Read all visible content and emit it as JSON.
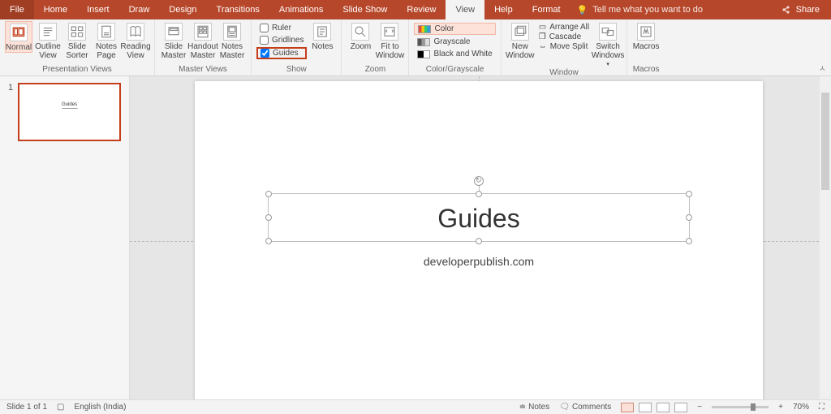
{
  "tabs": {
    "file": "File",
    "home": "Home",
    "insert": "Insert",
    "draw": "Draw",
    "design": "Design",
    "transitions": "Transitions",
    "animations": "Animations",
    "slideshow": "Slide Show",
    "review": "Review",
    "view": "View",
    "help": "Help",
    "format": "Format",
    "tellme": "Tell me what you want to do",
    "share": "Share"
  },
  "ribbon": {
    "presentation_views": "Presentation Views",
    "normal": "Normal",
    "outline_view": "Outline\nView",
    "slide_sorter": "Slide\nSorter",
    "notes_page": "Notes\nPage",
    "reading_view": "Reading\nView",
    "master_views": "Master Views",
    "slide_master": "Slide\nMaster",
    "handout_master": "Handout\nMaster",
    "notes_master": "Notes\nMaster",
    "show": "Show",
    "ruler": "Ruler",
    "gridlines": "Gridlines",
    "guides": "Guides",
    "notes": "Notes",
    "zoom_group": "Zoom",
    "zoom": "Zoom",
    "fit": "Fit to\nWindow",
    "cg_group": "Color/Grayscale",
    "color": "Color",
    "grayscale": "Grayscale",
    "bw": "Black and White",
    "window_group": "Window",
    "new_window": "New\nWindow",
    "arrange_all": "Arrange All",
    "cascade": "Cascade",
    "move_split": "Move Split",
    "switch_windows": "Switch\nWindows",
    "macros_group": "Macros",
    "macros": "Macros"
  },
  "thumb": {
    "num": "1",
    "title": "Guides"
  },
  "slide": {
    "title": "Guides",
    "subtitle": "developerpublish.com"
  },
  "status": {
    "slide": "Slide 1 of 1",
    "lang": "English (India)",
    "notes": "Notes",
    "comments": "Comments",
    "zoom": "70%",
    "minus": "−",
    "plus": "+"
  }
}
